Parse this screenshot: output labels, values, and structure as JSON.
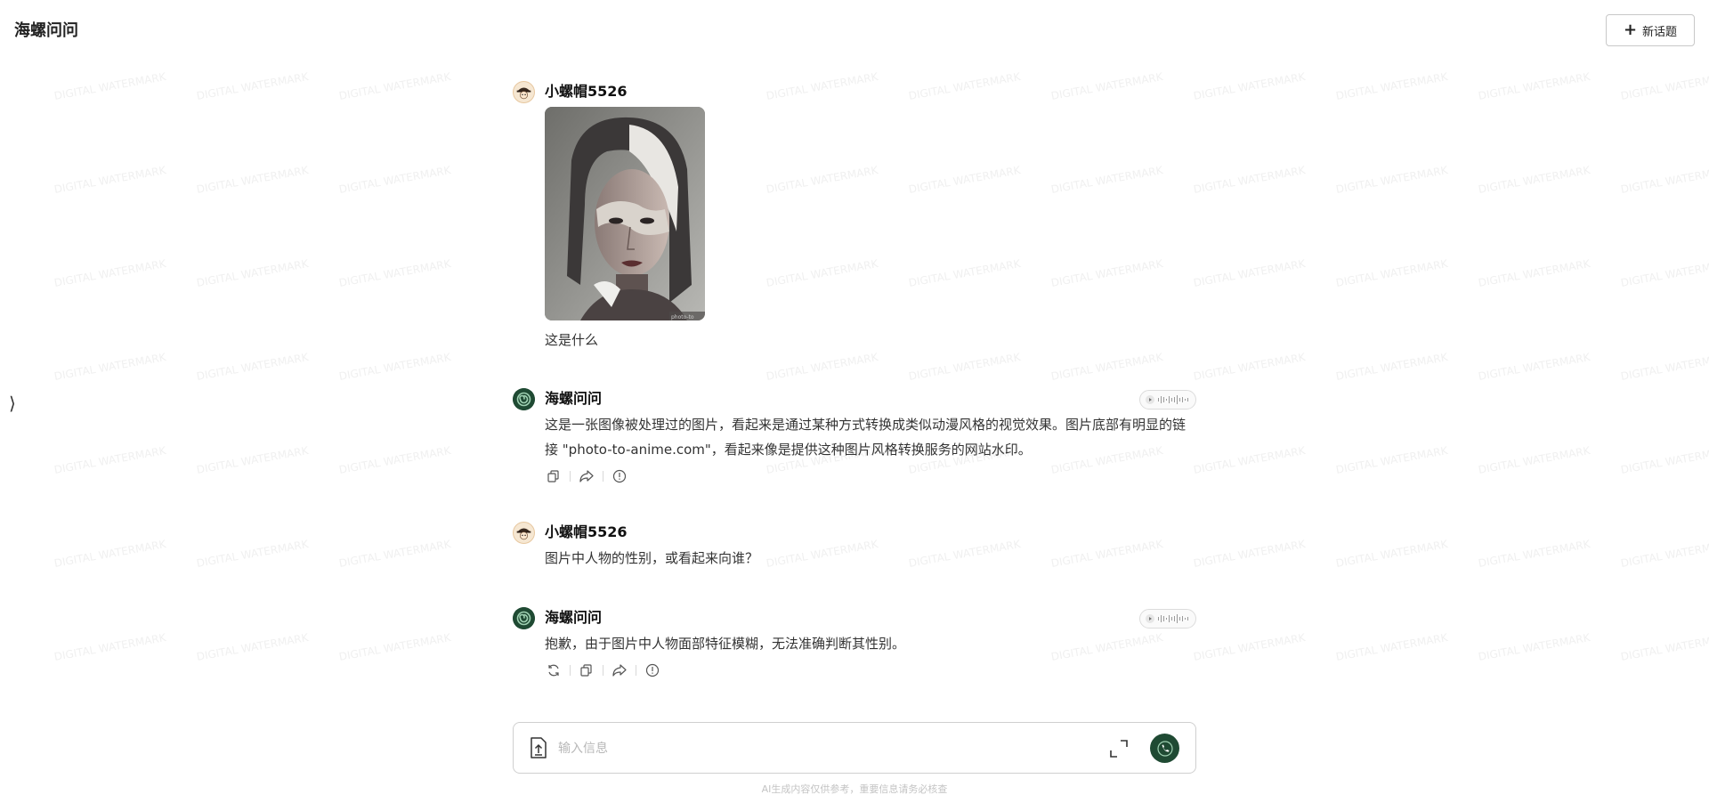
{
  "header": {
    "app_title": "海螺问问",
    "new_topic_label": "新话题"
  },
  "sidebar": {
    "toggle_glyph": "⟩"
  },
  "messages": [
    {
      "role": "user",
      "sender": "小螺帽5526",
      "avatar": "user-avatar",
      "has_image": true,
      "image_watermark": "photo-to",
      "text": "这是什么"
    },
    {
      "role": "assistant",
      "sender": "海螺问问",
      "avatar": "assistant-avatar",
      "text": "这是一张图像被处理过的图片，看起来是通过某种方式转换成类似动漫风格的视觉效果。图片底部有明显的链接 \"photo-to-anime.com\"，看起来像是提供这种图片风格转换服务的网站水印。",
      "actions": [
        "copy-icon",
        "share-icon",
        "report-icon"
      ]
    },
    {
      "role": "user",
      "sender": "小螺帽5526",
      "avatar": "user-avatar",
      "text": "图片中人物的性别，或看起来向谁？"
    },
    {
      "role": "assistant",
      "sender": "海螺问问",
      "avatar": "assistant-avatar",
      "text": "抱歉，由于图片中人物面部特征模糊，无法准确判断其性别。",
      "actions": [
        "regenerate-icon",
        "copy-icon",
        "share-icon",
        "report-icon"
      ]
    }
  ],
  "input": {
    "placeholder": "输入信息",
    "value": ""
  },
  "footer": {
    "disclaimer": "AI生成内容仅供参考，重要信息请务必核查"
  },
  "colors": {
    "brand_dark_green": "#1f4a33",
    "border": "#cfcfcf",
    "placeholder": "#b8b8b8"
  }
}
